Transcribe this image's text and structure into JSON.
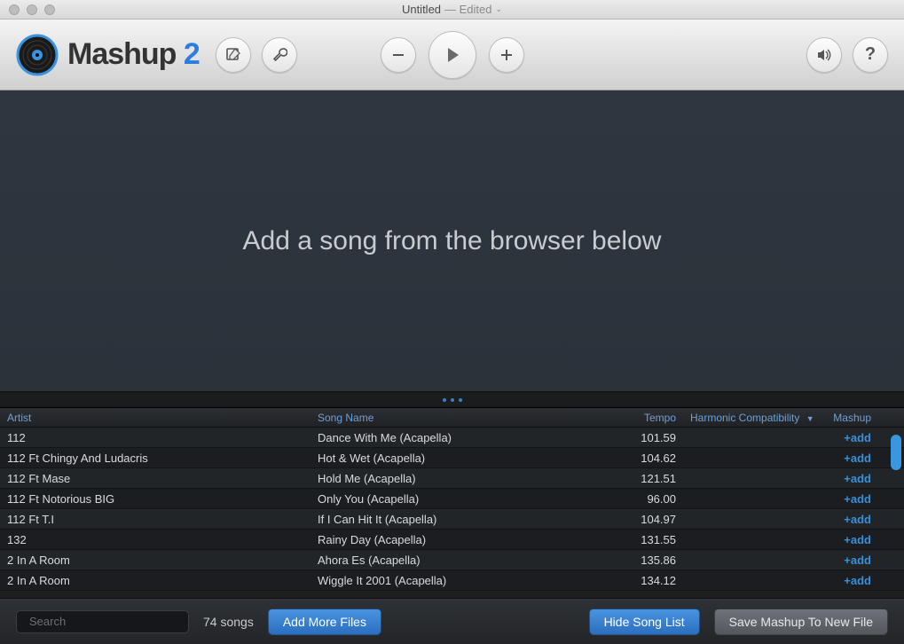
{
  "window": {
    "title": "Untitled",
    "status": "— Edited"
  },
  "workspace": {
    "message": "Add a song from the browser below"
  },
  "table": {
    "headers": {
      "artist": "Artist",
      "song": "Song Name",
      "tempo": "Tempo",
      "harm": "Harmonic Compatibility",
      "mashup": "Mashup"
    },
    "add_label": "+add",
    "rows": [
      {
        "artist": "112",
        "song": "Dance With Me (Acapella)",
        "tempo": "101.59"
      },
      {
        "artist": "112 Ft Chingy And Ludacris",
        "song": "Hot & Wet (Acapella)",
        "tempo": "104.62"
      },
      {
        "artist": "112 Ft Mase",
        "song": "Hold Me (Acapella)",
        "tempo": "121.51"
      },
      {
        "artist": "112 Ft Notorious BIG",
        "song": "Only You (Acapella)",
        "tempo": "96.00"
      },
      {
        "artist": "112 Ft T.I",
        "song": "If I Can Hit It (Acapella)",
        "tempo": "104.97"
      },
      {
        "artist": "132",
        "song": "Rainy Day (Acapella)",
        "tempo": "131.55"
      },
      {
        "artist": "2 In A Room",
        "song": "Ahora Es (Acapella)",
        "tempo": "135.86"
      },
      {
        "artist": "2 In A Room",
        "song": "Wiggle It 2001 (Acapella)",
        "tempo": "134.12"
      }
    ]
  },
  "footer": {
    "search_placeholder": "Search",
    "count": "74 songs",
    "add_more": "Add More Files",
    "hide_list": "Hide Song List",
    "save_mashup": "Save Mashup To New File"
  }
}
